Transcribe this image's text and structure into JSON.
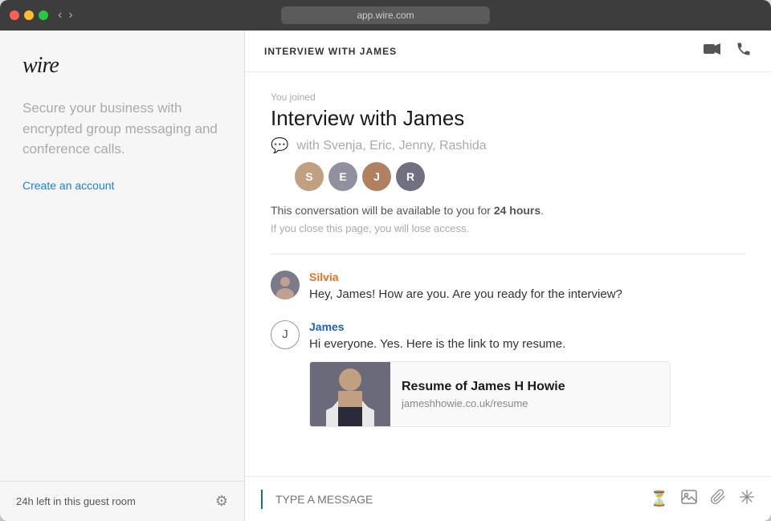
{
  "titlebar": {
    "url": "app.wire.com",
    "back_label": "‹",
    "forward_label": "›"
  },
  "sidebar": {
    "logo": "wire",
    "tagline": "Secure your business with encrypted group messaging and conference calls.",
    "create_account": "Create an account",
    "guest_timer": "24h left in this guest room"
  },
  "chat": {
    "header_title": "INTERVIEW WITH JAMES",
    "joined_label": "You joined",
    "interview_title": "Interview with James",
    "participants_label": "with Svenja, Eric, Jenny, Rashida",
    "notice_text_pre": "This conversation will be available to you for ",
    "notice_hours": "24 hours",
    "notice_text_post": ".",
    "lose_access_text": "If you close this page, you will lose access.",
    "messages": [
      {
        "sender": "Silvia",
        "sender_class": "silvia-name",
        "avatar_class": "silvia-av",
        "avatar_initials": "",
        "avatar_type": "photo",
        "text": "Hey, James! How are you. Are you ready for the interview?"
      },
      {
        "sender": "James",
        "sender_class": "james-name",
        "avatar_class": "james-av",
        "avatar_initials": "J",
        "avatar_type": "initial",
        "text": "Hi everyone. Yes. Here is the link to my resume.",
        "link_preview": {
          "title": "Resume of James H Howie",
          "url": "jameshhowie.co.uk/resume"
        }
      }
    ],
    "input_placeholder": "TYPE A MESSAGE"
  }
}
